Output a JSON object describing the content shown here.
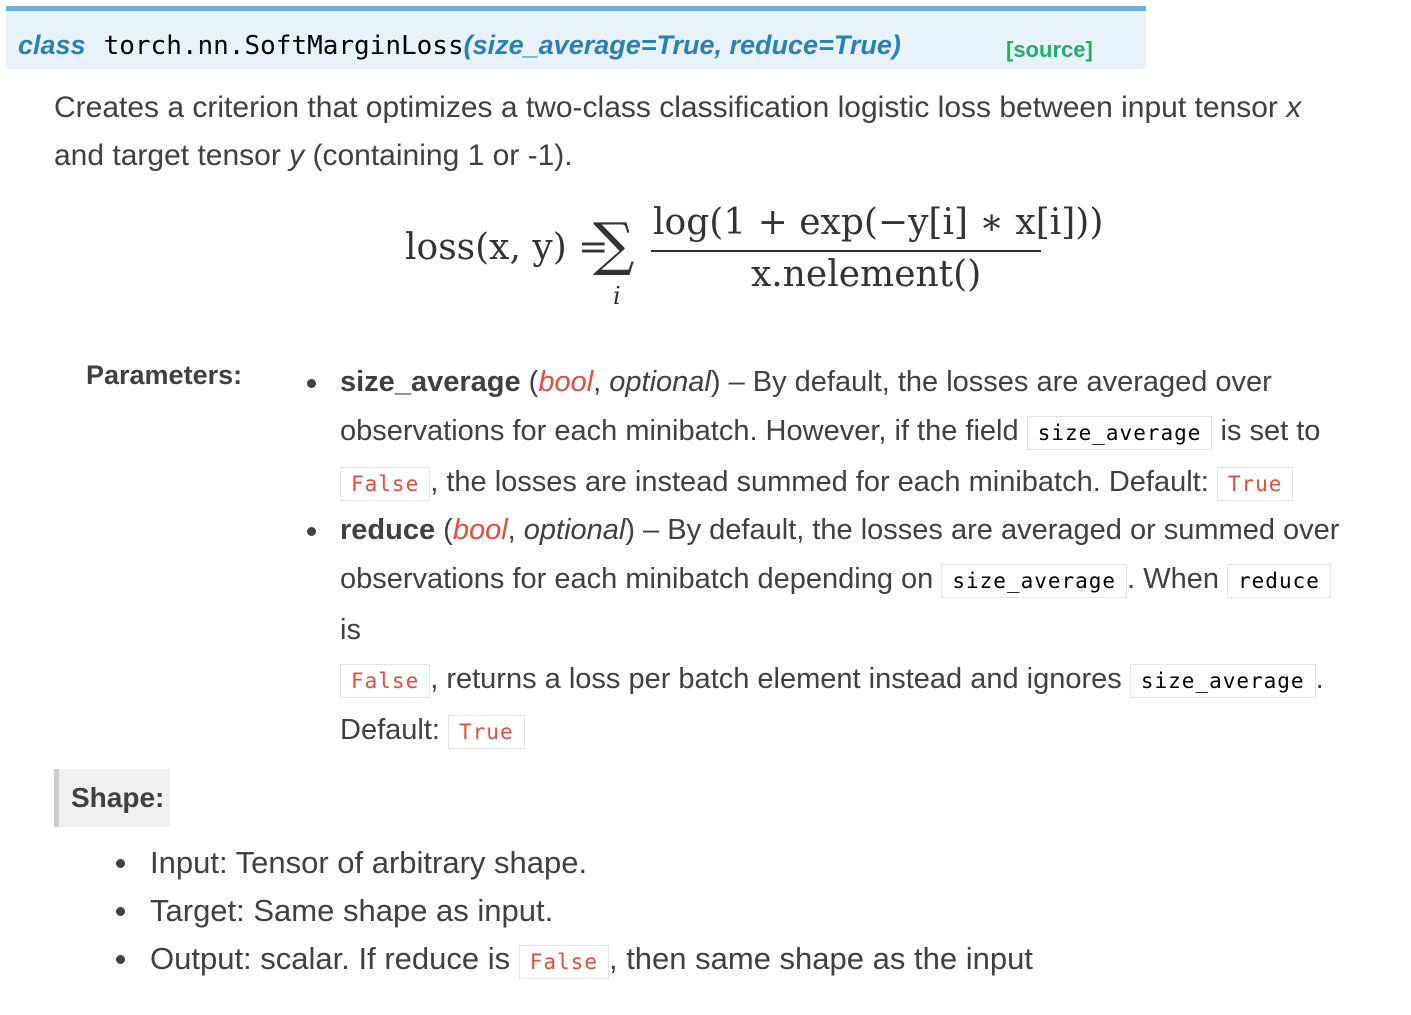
{
  "signature": {
    "keyword": "class",
    "name": "torch.nn.SoftMarginLoss",
    "open_paren": "(",
    "params": "size_average=True, reduce=True",
    "close_paren": ")",
    "source_link": "[source]"
  },
  "description": {
    "part1": "Creates a criterion that optimizes a two-class classification logistic loss between input tensor ",
    "x": "x",
    "part2": "and target tensor ",
    "y": "y",
    "part3": " (containing 1 or -1)."
  },
  "formula": {
    "lhs": "loss(x, y) =",
    "sigma": "∑",
    "subscript": "i",
    "numerator": "log(1 + exp(−y[i] ∗ x[i]))",
    "denominator": "x.nelement()"
  },
  "parameters": {
    "label": "Parameters:",
    "items": [
      {
        "name": "size_average",
        "type": "bool",
        "optional": "optional",
        "line1_text": ") – By default, the losses are averaged over",
        "line2_text": "observations for each minibatch. However, if the field",
        "line2_code": "size_average",
        "line2_tail": "is set to",
        "line3_code1": "False",
        "line3_text": ", the losses are instead summed for each minibatch. Default:",
        "line3_code2": "True"
      },
      {
        "name": "reduce",
        "type": "bool",
        "optional": "optional",
        "line1_text": ") – By default, the losses are averaged or summed over",
        "line2_text": "observations for each minibatch depending on",
        "line2_code1": "size_average",
        "line2_mid": ". When",
        "line2_code2": "reduce",
        "line2_tail": "is",
        "line3_code1": "False",
        "line3_text": ", returns a loss per batch element instead and ignores",
        "line3_code2": "size_average",
        "line3_tail": ".",
        "line4_text": "Default:",
        "line4_code": "True"
      }
    ]
  },
  "shape": {
    "label": "Shape:",
    "items": [
      "Input: Tensor of arbitrary shape.",
      "Target: Same shape as input."
    ],
    "output_text1": "Output: scalar. If reduce is",
    "output_code": "False",
    "output_text2": ", then same shape as the input"
  }
}
